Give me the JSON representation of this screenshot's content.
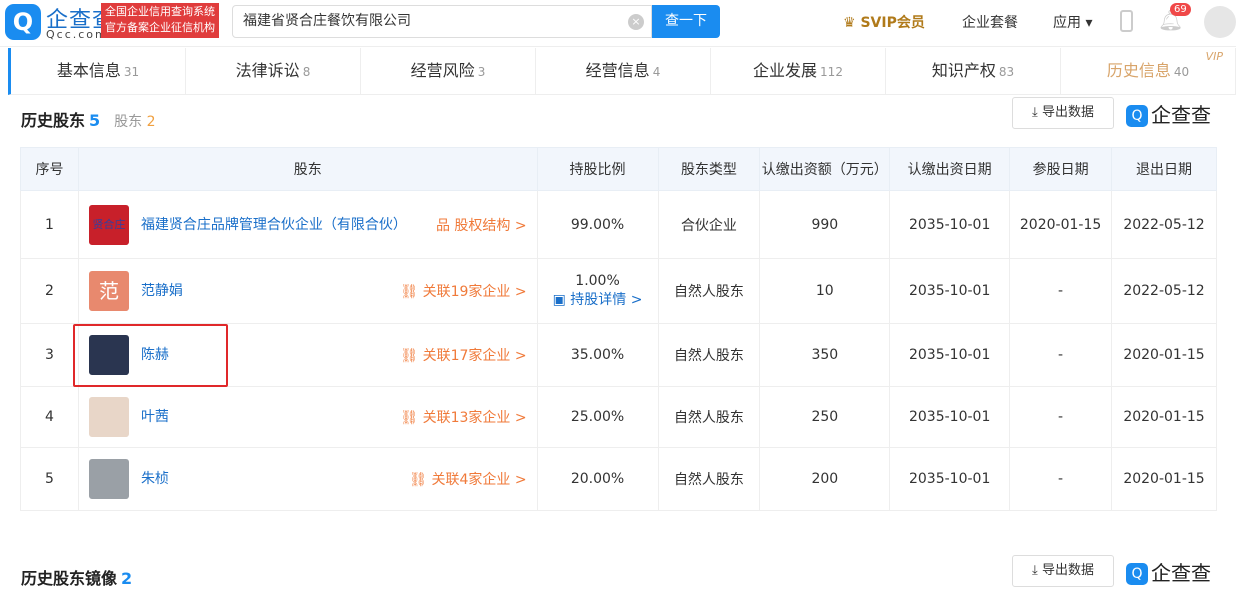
{
  "header": {
    "logo_text": "企查查",
    "logo_sub": "Qcc.com",
    "badge_line1": "全国企业信用查询系统",
    "badge_line2": "官方备案企业征信机构",
    "search_value": "福建省贤合庄餐饮有限公司",
    "search_button": "查一下",
    "svip": "SVIP会员",
    "package": "企业套餐",
    "apps": "应用",
    "notifications": "69"
  },
  "tabs": [
    {
      "label": "基本信息",
      "count": "31"
    },
    {
      "label": "法律诉讼",
      "count": "8"
    },
    {
      "label": "经营风险",
      "count": "3"
    },
    {
      "label": "经营信息",
      "count": "4"
    },
    {
      "label": "企业发展",
      "count": "112"
    },
    {
      "label": "知识产权",
      "count": "83"
    },
    {
      "label": "历史信息",
      "count": "40",
      "badge": "VIP"
    }
  ],
  "section1": {
    "title": "历史股东",
    "count": "5",
    "sub_label": "股东",
    "sub_count": "2",
    "export": "导出数据",
    "brand": "企查查"
  },
  "table": {
    "headers": [
      "序号",
      "股东",
      "持股比例",
      "股东类型",
      "认缴出资额（万元）",
      "认缴出资日期",
      "参股日期",
      "退出日期"
    ],
    "rows": [
      {
        "no": "1",
        "name": "福建贤合庄品牌管理合伙企业（有限合伙）",
        "avatar": "贤合庄",
        "avatar_color": "#c8202a",
        "link": "股权结构 >",
        "ratio": "99.00%",
        "detail": "",
        "type": "合伙企业",
        "amount": "990",
        "sub_date": "2035-10-01",
        "join": "2020-01-15",
        "exit": "2022-05-12"
      },
      {
        "no": "2",
        "name": "范静娟",
        "avatar": "范",
        "avatar_color": "#e8896e",
        "link": "关联19家企业 >",
        "ratio": "1.00%",
        "detail": "持股详情 >",
        "type": "自然人股东",
        "amount": "10",
        "sub_date": "2035-10-01",
        "join": "-",
        "exit": "2022-05-12"
      },
      {
        "no": "3",
        "name": "陈赫",
        "avatar": "",
        "avatar_color": "#2a3550",
        "link": "关联17家企业 >",
        "ratio": "35.00%",
        "detail": "",
        "type": "自然人股东",
        "amount": "350",
        "sub_date": "2035-10-01",
        "join": "-",
        "exit": "2020-01-15"
      },
      {
        "no": "4",
        "name": "叶茜",
        "avatar": "",
        "avatar_color": "#e8d6c8",
        "link": "关联13家企业 >",
        "ratio": "25.00%",
        "detail": "",
        "type": "自然人股东",
        "amount": "250",
        "sub_date": "2035-10-01",
        "join": "-",
        "exit": "2020-01-15"
      },
      {
        "no": "5",
        "name": "朱桢",
        "avatar": "",
        "avatar_color": "#9aa0a6",
        "link": "关联4家企业 >",
        "ratio": "20.00%",
        "detail": "",
        "type": "自然人股东",
        "amount": "200",
        "sub_date": "2035-10-01",
        "join": "-",
        "exit": "2020-01-15"
      }
    ]
  },
  "section2": {
    "title": "历史股东镜像",
    "count": "2",
    "export": "导出数据",
    "brand": "企查查"
  }
}
